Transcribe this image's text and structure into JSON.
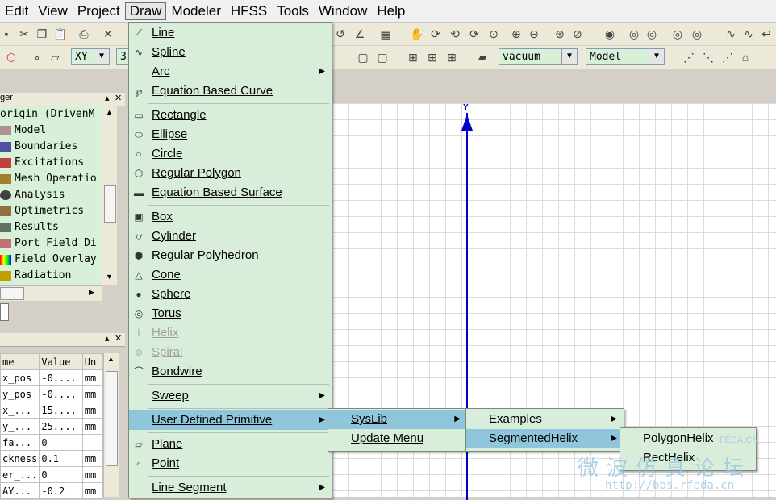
{
  "menubar": [
    "Edit",
    "View",
    "Project",
    "Draw",
    "Modeler",
    "HFSS",
    "Tools",
    "Window",
    "Help"
  ],
  "toolbar": {
    "plane_select": "XY",
    "view_select_partial": "3",
    "material_select": "vacuum",
    "model_select": "Model"
  },
  "project_manager": {
    "title_partial": "ger",
    "tree": [
      {
        "label": "origin (DrivenM",
        "icon": "none"
      },
      {
        "label": "Model",
        "icon": "model-icon"
      },
      {
        "label": "Boundaries",
        "icon": "boundaries-icon"
      },
      {
        "label": "Excitations",
        "icon": "excitations-icon"
      },
      {
        "label": "Mesh Operatio",
        "icon": "mesh-icon"
      },
      {
        "label": "Analysis",
        "icon": "analysis-icon"
      },
      {
        "label": "Optimetrics",
        "icon": "optimetrics-icon"
      },
      {
        "label": "Results",
        "icon": "results-icon"
      },
      {
        "label": "Port Field Di",
        "icon": "port-field-icon"
      },
      {
        "label": "Field Overlay",
        "icon": "field-overlay-icon"
      },
      {
        "label": "Radiation",
        "icon": "radiation-icon"
      }
    ]
  },
  "properties": {
    "columns": [
      "me",
      "Value",
      "Un"
    ],
    "rows": [
      [
        "x_pos",
        "-0....",
        "mm"
      ],
      [
        "y_pos",
        "-0....",
        "mm"
      ],
      [
        "x_...",
        "15....",
        "mm"
      ],
      [
        "y_...",
        "25....",
        "mm"
      ],
      [
        "fa...",
        "0",
        ""
      ],
      [
        "ckness",
        "0.1",
        "mm"
      ],
      [
        "er_...",
        "0",
        "mm"
      ],
      [
        "AY...",
        "-0.2",
        "mm"
      ]
    ]
  },
  "modeler": {
    "axis_label": "Y"
  },
  "draw_menu": {
    "items": [
      {
        "label": "Line",
        "icon": "line-icon",
        "submenu": false
      },
      {
        "label": "Spline",
        "icon": "spline-icon",
        "submenu": false
      },
      {
        "label": "Arc",
        "icon": "",
        "submenu": true
      },
      {
        "label": "Equation Based Curve",
        "icon": "equation-curve-icon",
        "submenu": false
      },
      {
        "label": "Rectangle",
        "icon": "rectangle-icon",
        "submenu": false
      },
      {
        "label": "Ellipse",
        "icon": "ellipse-icon",
        "submenu": false
      },
      {
        "label": "Circle",
        "icon": "circle-icon",
        "submenu": false
      },
      {
        "label": "Regular Polygon",
        "icon": "polygon-icon",
        "submenu": false
      },
      {
        "label": "Equation Based Surface",
        "icon": "equation-surface-icon",
        "submenu": false
      },
      {
        "label": "Box",
        "icon": "box-icon",
        "submenu": false
      },
      {
        "label": "Cylinder",
        "icon": "cylinder-icon",
        "submenu": false
      },
      {
        "label": "Regular Polyhedron",
        "icon": "polyhedron-icon",
        "submenu": false
      },
      {
        "label": "Cone",
        "icon": "cone-icon",
        "submenu": false
      },
      {
        "label": "Sphere",
        "icon": "sphere-icon",
        "submenu": false
      },
      {
        "label": "Torus",
        "icon": "torus-icon",
        "submenu": false
      },
      {
        "label": "Helix",
        "icon": "helix-icon",
        "submenu": false,
        "disabled": true
      },
      {
        "label": "Spiral",
        "icon": "spiral-icon",
        "submenu": false,
        "disabled": true
      },
      {
        "label": "Bondwire",
        "icon": "bondwire-icon",
        "submenu": false
      },
      {
        "label": "Sweep",
        "icon": "",
        "submenu": true
      },
      {
        "label": "User Defined Primitive",
        "icon": "",
        "submenu": true,
        "highlighted": true
      },
      {
        "label": "Plane",
        "icon": "plane-icon",
        "submenu": false
      },
      {
        "label": "Point",
        "icon": "point-icon",
        "submenu": false
      },
      {
        "label": "Line Segment",
        "icon": "",
        "submenu": true
      }
    ]
  },
  "udp_menu": {
    "items": [
      {
        "label": "SysLib",
        "submenu": true,
        "highlighted": true
      },
      {
        "label": "Update Menu",
        "submenu": false
      }
    ]
  },
  "syslib_menu": {
    "items": [
      {
        "label": "Examples",
        "submenu": true
      },
      {
        "label": "SegmentedHelix",
        "submenu": true,
        "highlighted": true
      }
    ]
  },
  "helix_menu": {
    "items": [
      {
        "label": "PolygonHelix"
      },
      {
        "label": "RectHelix"
      }
    ]
  },
  "watermark": {
    "site": "FEDA.CN",
    "cn": "微波仿真论坛",
    "url": "http://bbs.rfeda.cn"
  },
  "colors": {
    "menu_bg": "#d8eedb",
    "highlight": "#8fc6dc",
    "axis": "#0000cc",
    "tree_bg": "#d8efd8"
  }
}
